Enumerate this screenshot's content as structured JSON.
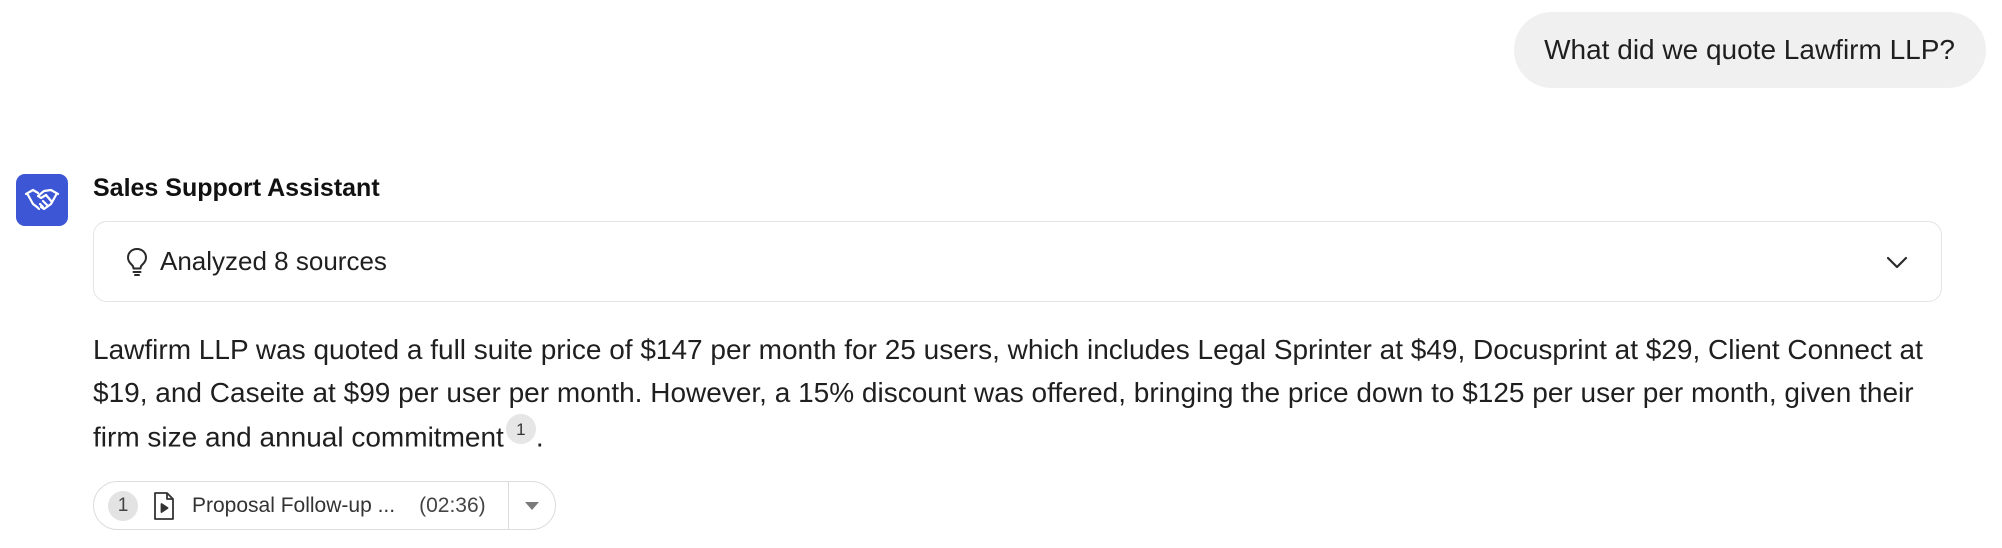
{
  "user_message": {
    "text": "What did we quote Lawfirm LLP?"
  },
  "assistant": {
    "name": "Sales Support Assistant",
    "avatar_icon": "handshake-icon",
    "avatar_color": "#3d56d6"
  },
  "sources_panel": {
    "label": "Analyzed 8 sources",
    "icon": "lightbulb-icon",
    "toggle_icon": "chevron-down-icon"
  },
  "answer": {
    "text": "Lawfirm LLP was quoted a full suite price of $147 per month for 25 users, which includes Legal Sprinter at $49, Docusprint at $29, Client Connect at $19, and Caseite at $99 per user per month. However, a 15% discount was offered, bringing the price down to $125 per user per month, given their firm size and annual commitment",
    "citation": "1",
    "trailing": "."
  },
  "source_chip": {
    "number": "1",
    "icon": "video-document-icon",
    "title": "Proposal Follow-up ...",
    "timestamp": "(02:36)",
    "dropdown_icon": "caret-down-icon"
  }
}
